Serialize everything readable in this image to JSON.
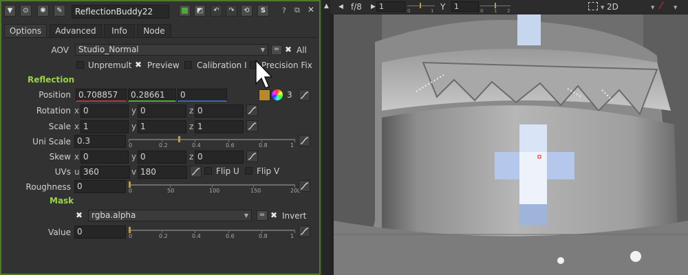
{
  "header": {
    "node_name": "ReflectionBuddy22",
    "icons": [
      "collapse-arrow-icon",
      "center-node-icon",
      "bug-icon",
      "wrench-icon",
      "node-color-icon",
      "mix-toggle-icon",
      "undo-icon",
      "redo-icon",
      "revert-icon",
      "script-icon",
      "float-panel-icon",
      "close-icon"
    ],
    "script_label": "S"
  },
  "tabs": [
    "Options",
    "Advanced",
    "Info",
    "Node"
  ],
  "options": {
    "aov": {
      "label": "AOV",
      "value": "Studio_Normal",
      "eq": "=",
      "all": "All"
    },
    "unpremult": "Unpremult",
    "preview": "Preview",
    "calibration": "Calibration Ir",
    "precision": "Precision Fix",
    "reflection_section": "Reflection",
    "position": {
      "label": "Position",
      "x": "0.708857",
      "y": "0.28661",
      "z": "0",
      "channels": "3"
    },
    "rotation": {
      "label": "Rotation",
      "x": "0",
      "y": "0",
      "z": "0"
    },
    "scale": {
      "label": "Scale",
      "x": "1",
      "y": "1",
      "z": "1"
    },
    "uni_scale": {
      "label": "Uni Scale",
      "value": "0.3",
      "slider_value": 0.3
    },
    "skew": {
      "label": "Skew",
      "x": "0",
      "y": "0",
      "z": "0"
    },
    "uvs": {
      "label": "UVs",
      "u": "360",
      "v": "180",
      "flip_u": "Flip U",
      "flip_v": "Flip V"
    },
    "roughness": {
      "label": "Roughness",
      "value": "0",
      "slider_value": 0
    },
    "mask_section": "Mask",
    "mask": {
      "channel": "rgba.alpha",
      "eq": "=",
      "invert": "Invert"
    },
    "value": {
      "label": "Value",
      "value": "0",
      "slider_value": 0
    },
    "axis_labels": {
      "x": "x",
      "y": "y",
      "z": "z",
      "u": "u",
      "v": "v"
    },
    "slider_ticks_unit": [
      "0",
      "0.2",
      "0.4",
      "0.6",
      "0.8",
      "1"
    ],
    "slider_ticks_rough": [
      "0",
      "50",
      "100",
      "150",
      "200"
    ]
  },
  "viewer": {
    "fstop": "f/8",
    "frame": "1",
    "gain_ticks": [
      "0",
      "1"
    ],
    "gamma_label": "Y",
    "gamma": "1",
    "gamma_ticks": [
      "0",
      "1",
      "2"
    ],
    "view_mode": "2D"
  },
  "colors": {
    "accent_green": "#9ad24a",
    "panel_border": "#4f7a2a",
    "highlight": "#c8daf7"
  }
}
